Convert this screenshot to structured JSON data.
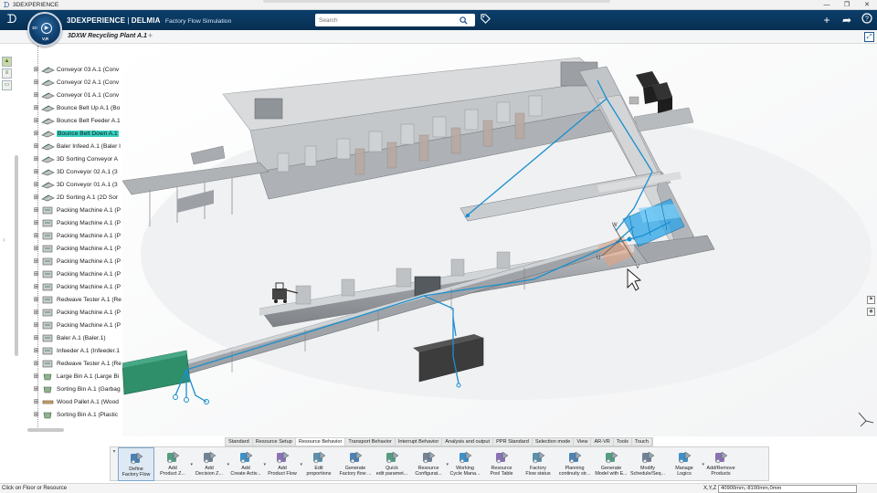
{
  "os": {
    "title": "3DEXPERIENCE",
    "controls": [
      "—",
      "❐",
      "✕"
    ]
  },
  "header": {
    "brand": "3DEXPERIENCE",
    "separator": " | ",
    "brand2": "DELMIA",
    "app_name": "Factory Flow Simulation",
    "search_placeholder": "Search"
  },
  "compass": {
    "label_3d": "3D",
    "version": "V,R"
  },
  "tab": {
    "title": "3DXW Recycling Plant A.1",
    "add": "+"
  },
  "tree": {
    "items": [
      {
        "label": "Conveyor 03 A.1 (Conv",
        "icon": "conveyor"
      },
      {
        "label": "Conveyor 02 A.1 (Conv",
        "icon": "conveyor"
      },
      {
        "label": "Conveyor 01 A.1 (Conv",
        "icon": "conveyor"
      },
      {
        "label": "Bounce Belt Up A.1 (Bo",
        "icon": "conveyor"
      },
      {
        "label": "Bounce Belt Feeder A.1",
        "icon": "conveyor"
      },
      {
        "label": "Bounce Belt Down A.1",
        "icon": "conveyor",
        "selected": true
      },
      {
        "label": "Baler Infeed A.1 (Baler I",
        "icon": "conveyor"
      },
      {
        "label": "3D Sorting Conveyor A",
        "icon": "conveyor"
      },
      {
        "label": "3D Conveyor 02 A.1 (3",
        "icon": "conveyor"
      },
      {
        "label": "3D Conveyor 01 A.1 (3",
        "icon": "conveyor"
      },
      {
        "label": "2D Sorting A.1 (2D Sor",
        "icon": "conveyor"
      },
      {
        "label": "Packing Machine A.1 (P",
        "icon": "machine"
      },
      {
        "label": "Packing Machine A.1 (P",
        "icon": "machine"
      },
      {
        "label": "Packing Machine A.1 (P",
        "icon": "machine"
      },
      {
        "label": "Packing Machine A.1 (P",
        "icon": "machine"
      },
      {
        "label": "Packing Machine A.1 (P",
        "icon": "machine"
      },
      {
        "label": "Packing Machine A.1 (P",
        "icon": "machine"
      },
      {
        "label": "Packing Machine A.1 (P",
        "icon": "machine"
      },
      {
        "label": "Redwave Tester A.1 (Re",
        "icon": "machine"
      },
      {
        "label": "Packing Machine A.1 (P",
        "icon": "machine"
      },
      {
        "label": "Packing Machine A.1 (P",
        "icon": "machine"
      },
      {
        "label": "Baler A.1 (Baler.1)",
        "icon": "machine"
      },
      {
        "label": "Infeeder A.1 (Infeeder.1",
        "icon": "machine"
      },
      {
        "label": "Redwave Tester A.1 (Re",
        "icon": "machine"
      },
      {
        "label": "Large Bin A.1 (Large Bi",
        "icon": "bin"
      },
      {
        "label": "Sorting Bin A.1 (Garbag",
        "icon": "bin"
      },
      {
        "label": "Wood Pallet A.1 (Wood",
        "icon": "pallet"
      },
      {
        "label": "Sorting Bin A.1 (Plastic",
        "icon": "bin"
      }
    ]
  },
  "viewport": {
    "handle_labels": [
      "W",
      "U",
      "V"
    ],
    "colors": {
      "flow_line": "#1a8fd0",
      "highlight": "#2aa4e8",
      "bin_dark": "#3c3c3c",
      "green_conveyor": "#2f8f6a"
    }
  },
  "actionbar": {
    "tabs": [
      {
        "label": "Standard"
      },
      {
        "label": "Resource Setup"
      },
      {
        "label": "Resource Behavior",
        "active": true
      },
      {
        "label": "Transport Behavior"
      },
      {
        "label": "Interrupt Behavior"
      },
      {
        "label": "Analysis and output"
      },
      {
        "label": "PPR Standard"
      },
      {
        "label": "Selection mode"
      },
      {
        "label": "View"
      },
      {
        "label": "AR-VR"
      },
      {
        "label": "Tools"
      },
      {
        "label": "Touch"
      }
    ],
    "tools": [
      {
        "label": "Define\nFactory Flow",
        "icon": "define-flow-icon",
        "drop": false
      },
      {
        "label": "Add\nProduct Z...",
        "icon": "add-product-zone-icon",
        "drop": true
      },
      {
        "label": "Add\nDecision Z...",
        "icon": "add-decision-zone-icon",
        "drop": true
      },
      {
        "label": "Add\nCreate Activ...",
        "icon": "add-create-activity-icon",
        "drop": true
      },
      {
        "label": "Add\nProduct Flow",
        "icon": "add-product-flow-icon",
        "drop": true
      },
      {
        "label": "Edit\nproportions",
        "icon": "edit-proportions-icon",
        "drop": false
      },
      {
        "label": "Generate\nFactory flow ...",
        "icon": "generate-factory-flow-icon",
        "drop": false
      },
      {
        "label": "Quick\nedit paramet...",
        "icon": "quick-edit-icon",
        "drop": false
      },
      {
        "label": "Resource\nConfigurat...",
        "icon": "resource-config-icon",
        "drop": true
      },
      {
        "label": "Working\nCycle Mana...",
        "icon": "working-cycle-icon",
        "drop": false
      },
      {
        "label": "Resource\nPool Table",
        "icon": "resource-pool-icon",
        "drop": false
      },
      {
        "label": "Factory\nFlow status",
        "icon": "flow-status-icon",
        "drop": false
      },
      {
        "label": "Planning\ncontinuity str...",
        "icon": "planning-continuity-icon",
        "drop": false
      },
      {
        "label": "Generate\nModel with E...",
        "icon": "generate-model-icon",
        "drop": false
      },
      {
        "label": "Modify\nSchedule/Seq...",
        "icon": "modify-schedule-icon",
        "drop": false
      },
      {
        "label": "Manage\nLogics",
        "icon": "manage-logics-icon",
        "drop": true
      },
      {
        "label": "Add/Remove\nProducts",
        "icon": "add-remove-products-icon",
        "drop": false
      }
    ]
  },
  "status": {
    "message": "Click on Floor or Resource",
    "coord_label": "X,Y,Z",
    "coord_value": "40900mm,-8100mm,0mm"
  }
}
